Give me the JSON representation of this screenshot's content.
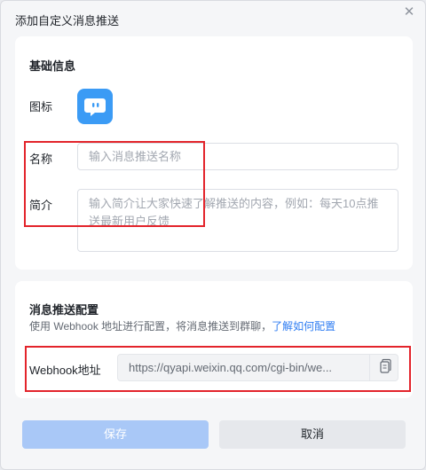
{
  "dialog": {
    "title": "添加自定义消息推送",
    "close_icon": "close-icon"
  },
  "basic": {
    "section_title": "基础信息",
    "icon_label": "图标",
    "app_icon": "chat-bubble-icon",
    "name_label": "名称",
    "name_value": "",
    "name_placeholder": "输入消息推送名称",
    "intro_label": "简介",
    "intro_value": "",
    "intro_placeholder": "输入简介让大家快速了解推送的内容，例如：每天10点推送最新用户反馈"
  },
  "config": {
    "section_title": "消息推送配置",
    "desc_text": "使用 Webhook 地址进行配置，将消息推送到群聊，",
    "desc_link": "了解如何配置",
    "webhook_label": "Webhook地址",
    "webhook_url": "https://qyapi.weixin.qq.com/cgi-bin/we...",
    "copy_icon": "copy-icon"
  },
  "footer": {
    "save_label": "保存",
    "cancel_label": "取消"
  },
  "colors": {
    "accent": "#2f7df2",
    "app_icon_bg": "#3b9bf5",
    "save_disabled": "#a9c8f7",
    "highlight_border": "#e3242b"
  }
}
